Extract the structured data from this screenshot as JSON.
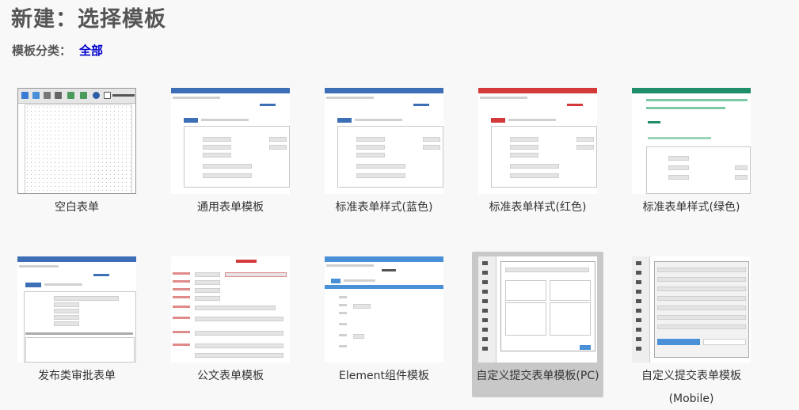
{
  "header": {
    "title": "新建：选择模板",
    "category_label": "模板分类：",
    "category_value": "全部"
  },
  "templates": [
    {
      "label": "空白表单",
      "style": "blank"
    },
    {
      "label": "通用表单模板",
      "style": "blue",
      "accent": "#3d6fb6"
    },
    {
      "label": "标准表单样式(蓝色)",
      "style": "blue",
      "accent": "#3d6fb6"
    },
    {
      "label": "标准表单样式(红色)",
      "style": "red",
      "accent": "#d43a3a"
    },
    {
      "label": "标准表单样式(绿色)",
      "style": "green",
      "accent": "#1f8f6b"
    },
    {
      "label": "发布类审批表单",
      "style": "blue",
      "accent": "#3d6fb6"
    },
    {
      "label": "公文表单模板",
      "style": "doc",
      "accent": "#d43a3a"
    },
    {
      "label": "Element组件模板",
      "style": "element",
      "accent": "#4a90d9"
    },
    {
      "label": "自定义提交表单模板(PC)",
      "style": "custom",
      "selected": true
    },
    {
      "label": "自定义提交表单模板(Mobile)",
      "label_line1": "自定义提交表单模板",
      "label_line2": "(Mobile)",
      "style": "mobile"
    }
  ]
}
